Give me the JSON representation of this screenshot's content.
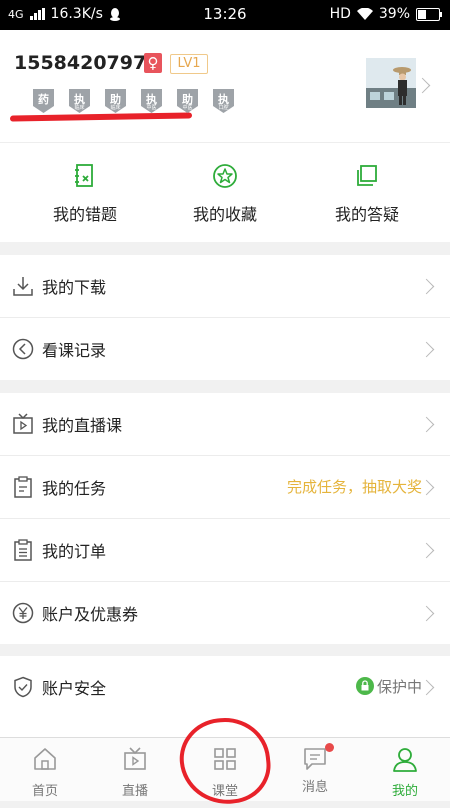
{
  "status_bar": {
    "network": "4G",
    "speed": "16.3K/s",
    "time": "13:26",
    "hd": "HD",
    "battery": "39%"
  },
  "profile": {
    "phone": "15584207977",
    "gender_symbol": "♀",
    "level": "LV1",
    "badges": [
      {
        "icon": "pharmacist-badge-icon",
        "title": "药",
        "sub": ""
      },
      {
        "icon": "clinical-practitioner-badge-icon",
        "title": "执",
        "sub": "临床"
      },
      {
        "icon": "clinical-assistant-badge-icon",
        "title": "助",
        "sub": "临床"
      },
      {
        "icon": "tcm-practitioner-badge-icon",
        "title": "执",
        "sub": "中医"
      },
      {
        "icon": "tcm-assistant-badge-icon",
        "title": "助",
        "sub": "中医"
      },
      {
        "icon": "dental-practitioner-badge-icon",
        "title": "执",
        "sub": "口腔"
      }
    ]
  },
  "quick_actions": [
    {
      "icon": "wrong-questions-icon",
      "label": "我的错题"
    },
    {
      "icon": "star-favorites-icon",
      "label": "我的收藏"
    },
    {
      "icon": "answers-icon",
      "label": "我的答疑"
    }
  ],
  "section1": [
    {
      "icon": "download-icon",
      "label": "我的下载"
    },
    {
      "icon": "history-icon",
      "label": "看课记录"
    }
  ],
  "section2": [
    {
      "icon": "live-tv-icon",
      "label": "我的直播课"
    },
    {
      "icon": "tasks-icon",
      "label": "我的任务",
      "right": "完成任务，抽取大奖"
    },
    {
      "icon": "orders-icon",
      "label": "我的订单"
    },
    {
      "icon": "yen-coupon-icon",
      "label": "账户及优惠券"
    }
  ],
  "section3": [
    {
      "icon": "shield-icon",
      "label": "账户安全",
      "right": "保护中"
    }
  ],
  "tabs": [
    {
      "icon": "home-icon",
      "label": "首页"
    },
    {
      "icon": "tv-icon",
      "label": "直播"
    },
    {
      "icon": "grid-icon",
      "label": "课堂"
    },
    {
      "icon": "message-icon",
      "label": "消息"
    },
    {
      "icon": "user-icon",
      "label": "我的"
    }
  ],
  "colors": {
    "accent": "#2eac3a",
    "promo": "#e5b43c",
    "annotation": "#e8222a"
  }
}
